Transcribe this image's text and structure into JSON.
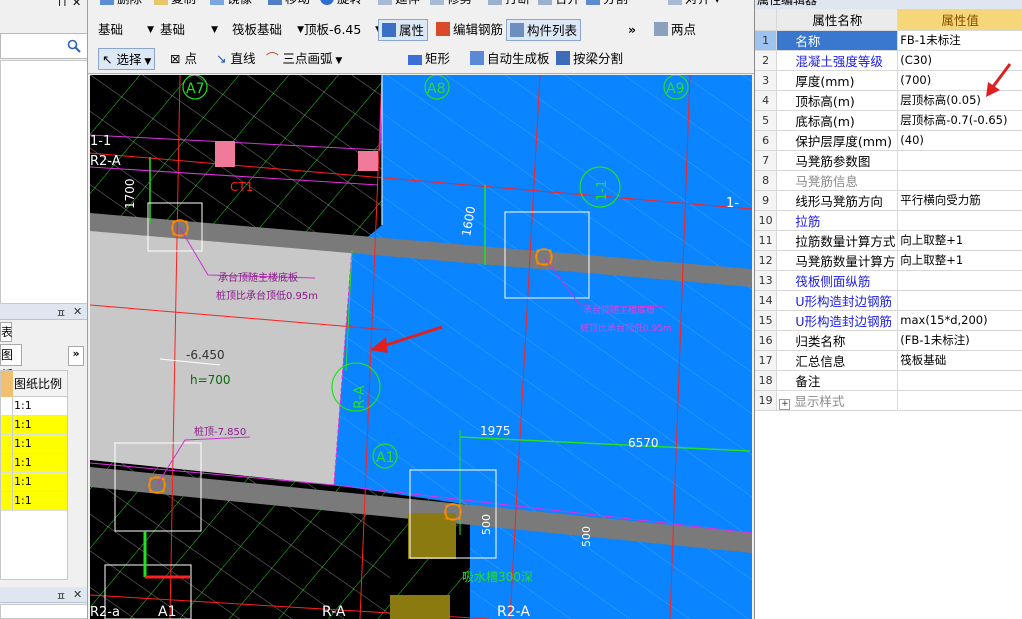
{
  "toolbar": {
    "row1": {
      "delete_label": "删除",
      "copy_label": "复制",
      "mirror_label": "镜像",
      "move_label": "移动",
      "rotate_label": "旋转",
      "extend_label": "延伸",
      "trim_label": "修剪",
      "break_label": "打断",
      "merge_label": "合并",
      "split_label": "分割",
      "align_label": "对齐"
    },
    "row2": {
      "dropdown1": "基础",
      "dropdown2": "基础",
      "dropdown3": "筏板基础",
      "dropdown4": "顶板-6.45",
      "property_label": "属性",
      "edit_rebar_label": "编辑钢筋",
      "component_list_label": "构件列表",
      "two_point_label": "两点"
    },
    "row3": {
      "select_label": "选择",
      "point_label": "点",
      "line_label": "直线",
      "arc_label": "三点画弧",
      "rect_label": "矩形",
      "auto_gen_label": "自动生成板",
      "split_by_beam_label": "按梁分割"
    }
  },
  "left_panel": {
    "tab_label": "表",
    "drawing_tab_label": "图纸",
    "col_header": "图纸比例",
    "rows": [
      "1:1",
      "1:1",
      "1:1",
      "1:1",
      "1:1",
      "1:1"
    ]
  },
  "canvas": {
    "axis_labels": {
      "a7": "A7",
      "a8": "A8",
      "a9": "A9",
      "a1": "A1",
      "a1b": "A1",
      "sec1": "1-1",
      "sec2": "1-1",
      "sec3": "1-",
      "ra1": "R-A",
      "ra2": "R-A",
      "r2a": "R2-A",
      "r2a2": "R2-A",
      "r2a3": "R2-a",
      "ct1": "CT1"
    },
    "dims": {
      "d1700": "1700",
      "d1600": "1600",
      "d1975": "1975",
      "d6570": "6570",
      "d500": "500",
      "d500b": "500"
    },
    "notes": {
      "elev": "-6.450",
      "h": "h=700",
      "pile_top": "桩顶-7.850",
      "cap_note1": "承台顶随主楼底板",
      "cap_note2": "桩顶比承台顶低0.95m",
      "cap_note3": "承台顶随主楼底板",
      "cap_note4": "桩顶比承台顶低0.95m",
      "sump": "吸水槽300深"
    }
  },
  "properties": {
    "title": "属性编辑器",
    "header_name": "属性名称",
    "header_value": "属性值",
    "rows": [
      {
        "num": "1",
        "name": "名称",
        "value": "FB-1未标注"
      },
      {
        "num": "2",
        "name": "混凝土强度等级",
        "value": "(C30)"
      },
      {
        "num": "3",
        "name": "厚度(mm)",
        "value": "(700)"
      },
      {
        "num": "4",
        "name": "顶标高(m)",
        "value": "层顶标高(0.05)"
      },
      {
        "num": "5",
        "name": "底标高(m)",
        "value": "层顶标高-0.7(-0.65)"
      },
      {
        "num": "6",
        "name": "保护层厚度(mm)",
        "value": "(40)"
      },
      {
        "num": "7",
        "name": "马凳筋参数图",
        "value": ""
      },
      {
        "num": "8",
        "name": "马凳筋信息",
        "value": ""
      },
      {
        "num": "9",
        "name": "线形马凳筋方向",
        "value": "平行横向受力筋"
      },
      {
        "num": "10",
        "name": "拉筋",
        "value": ""
      },
      {
        "num": "11",
        "name": "拉筋数量计算方式",
        "value": "向上取整+1"
      },
      {
        "num": "12",
        "name": "马凳筋数量计算方",
        "value": "向上取整+1"
      },
      {
        "num": "13",
        "name": "筏板侧面纵筋",
        "value": ""
      },
      {
        "num": "14",
        "name": "U形构造封边钢筋",
        "value": ""
      },
      {
        "num": "15",
        "name": "U形构造封边钢筋",
        "value": "max(15*d,200)"
      },
      {
        "num": "16",
        "name": "归类名称",
        "value": "(FB-1未标注)"
      },
      {
        "num": "17",
        "name": "汇总信息",
        "value": "筏板基础"
      },
      {
        "num": "18",
        "name": "备注",
        "value": ""
      },
      {
        "num": "19",
        "name": "显示样式",
        "value": ""
      }
    ]
  },
  "colors": {
    "slab_blue": "#0a84ff",
    "slab_gray": "#c8c8c8",
    "annotation_red": "#e02020",
    "selected_row": "#3a78d0",
    "header_value_bg": "#f5d77a"
  }
}
